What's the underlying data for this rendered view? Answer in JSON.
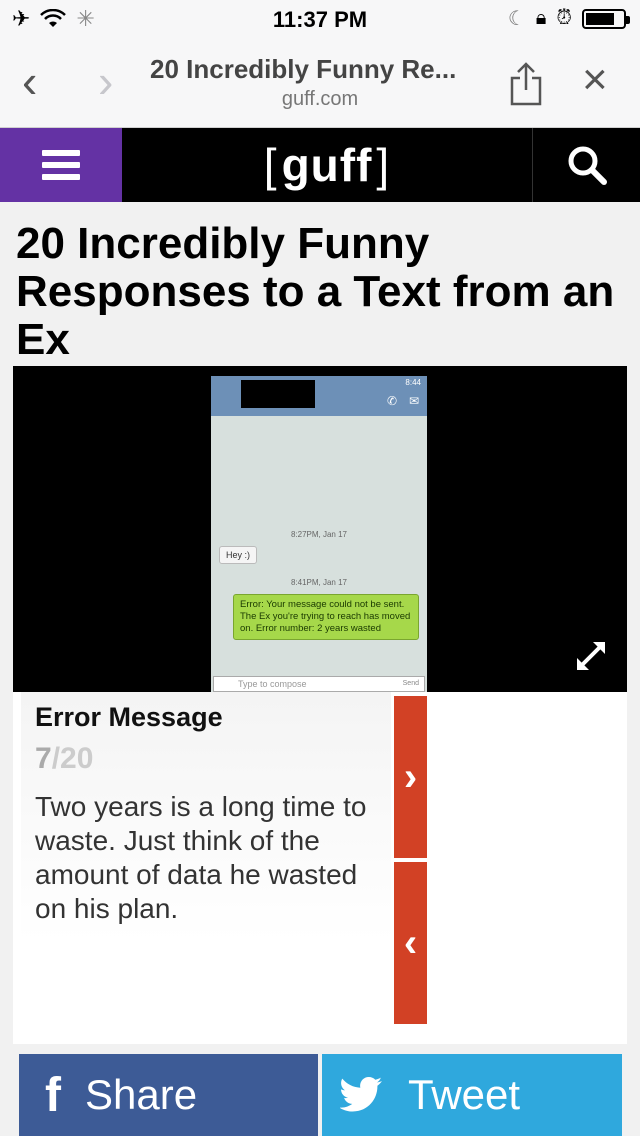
{
  "status_bar": {
    "time": "11:37 PM",
    "icons": [
      "airplane-icon",
      "wifi-icon",
      "loading-icon",
      "moon-icon",
      "rotation-lock-icon",
      "alarm-icon",
      "battery-icon"
    ]
  },
  "browser": {
    "title": "20 Incredibly Funny Re...",
    "url": "guff.com",
    "back_icon": "‹",
    "forward_icon": "›",
    "close_icon": "×"
  },
  "site": {
    "logo": "guff",
    "menu_color": "#6432a4"
  },
  "article": {
    "title": "20 Incredibly Funny Responses to a Text from an Ex"
  },
  "screenshot": {
    "status_time": "8:44",
    "ts1": "8:27PM, Jan 17",
    "msg_in": "Hey :)",
    "ts2": "8:41PM, Jan 17",
    "msg_out": "Error: Your message could not be sent. The Ex you're trying to reach has moved on. Error number: 2 years wasted",
    "compose_placeholder": "Type to compose",
    "send_label": "Send"
  },
  "slide": {
    "title": "Error Message",
    "current": "7",
    "total": "/20",
    "text": "Two years is a long time to waste. Just think of the amount of data he wasted on his plan.",
    "next_icon": "›",
    "prev_icon": "‹",
    "accent": "#d24125"
  },
  "share": {
    "facebook_label": "Share",
    "facebook_icon": "f",
    "facebook_color": "#3d5b96",
    "twitter_label": "Tweet",
    "twitter_color": "#2fa8dd"
  }
}
